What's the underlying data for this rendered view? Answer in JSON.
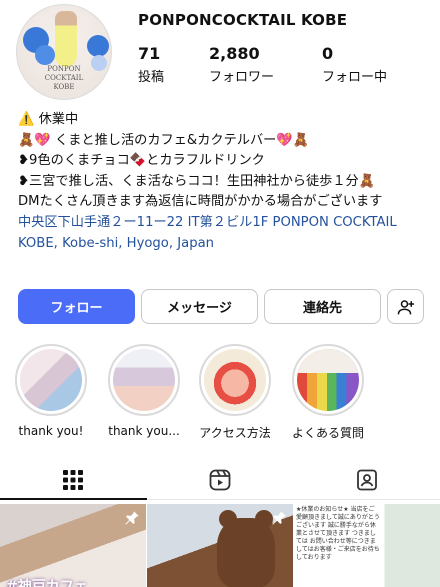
{
  "profile": {
    "username": "PONPONCOCKTAIL KOBE",
    "avatar_text": [
      "PONPON",
      "COCKTAIL",
      "KOBE"
    ]
  },
  "stats": {
    "posts": {
      "value": "71",
      "label": "投稿"
    },
    "followers": {
      "value": "2,880",
      "label": "フォロワー"
    },
    "following": {
      "value": "0",
      "label": "フォロー中"
    }
  },
  "bio": {
    "line1": "⚠️ 休業中",
    "line2": "🧸💖 くまと推し活のカフェ&カクテルバー💖🧸",
    "line3": "❥9色のくまチョコ🍫とカラフルドリンク",
    "line4": "❥三宮で推し活、くま活ならココ！生田神社から徒歩１分🧸",
    "line5": "DMたくさん頂きます為返信に時間がかかる場合がございます",
    "location": "中央区下山手通２ー11ー22  IT第２ビル1F PONPON COCKTAIL KOBE, Kobe-shi, Hyogo, Japan"
  },
  "buttons": {
    "follow": "フォロー",
    "message": "メッセージ",
    "contact": "連絡先"
  },
  "highlights": [
    {
      "label": "thank you!"
    },
    {
      "label": "thank you..."
    },
    {
      "label": "アクセス方法"
    },
    {
      "label": "よくある質問"
    }
  ],
  "tabs": {
    "active": "grid",
    "icons": [
      "grid-icon",
      "reels-icon",
      "tagged-icon"
    ]
  },
  "posts": [
    {
      "caption": "#神戸カフェ",
      "pinned": true
    },
    {
      "caption": "",
      "pinned": true
    },
    {
      "note": "★休業のお知らせ★ 当店をご愛顧頂きまして誠にありがとうございます 誠に勝手ながら休業とさせて頂きます つきましては お問い合わせ等につきましてはお客様・ご来店をお待ちしております",
      "pinned": false
    }
  ],
  "colors": {
    "primary_button": "#4a6cf7",
    "link": "#24529d"
  }
}
